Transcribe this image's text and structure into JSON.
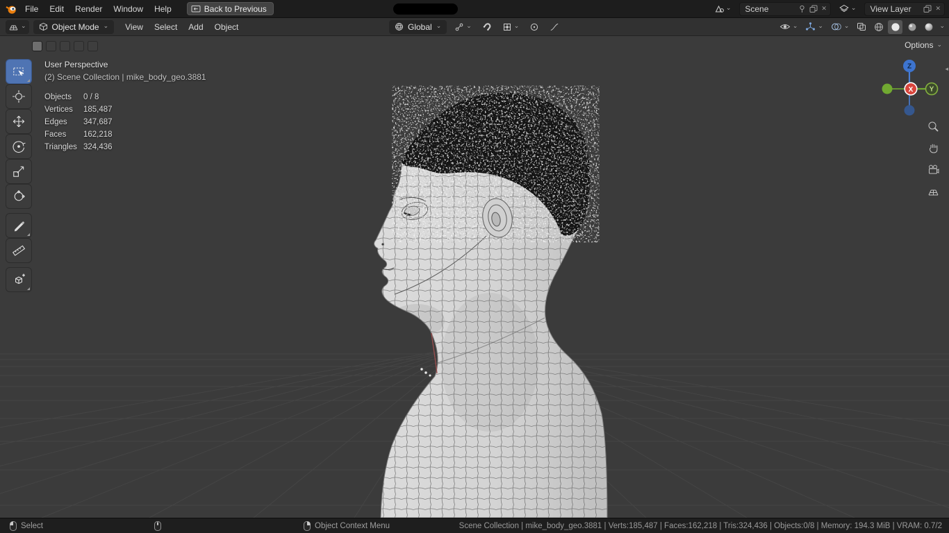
{
  "topbar": {
    "menus": [
      "File",
      "Edit",
      "Render",
      "Window",
      "Help"
    ],
    "back_button": "Back to Previous",
    "scene_field": "Scene",
    "view_layer_field": "View Layer"
  },
  "header": {
    "mode": "Object Mode",
    "menus": [
      "View",
      "Select",
      "Add",
      "Object"
    ],
    "orientation": "Global",
    "options": "Options"
  },
  "viewport_overlay": {
    "perspective": "User Perspective",
    "context": "(2) Scene Collection | mike_body_geo.3881",
    "stats": [
      {
        "label": "Objects",
        "value": "0 / 8"
      },
      {
        "label": "Vertices",
        "value": "185,487"
      },
      {
        "label": "Edges",
        "value": "347,687"
      },
      {
        "label": "Faces",
        "value": "162,218"
      },
      {
        "label": "Triangles",
        "value": "324,436"
      }
    ]
  },
  "gizmo": {
    "x": "X",
    "y": "Y",
    "z": "Z"
  },
  "toolbar_tools": [
    "box-select",
    "cursor",
    "move",
    "rotate",
    "scale",
    "transform",
    "annotate",
    "measure",
    "add-cube"
  ],
  "statusbar": {
    "select_label": "Select",
    "context_menu_label": "Object Context Menu",
    "info": "Scene Collection | mike_body_geo.3881 | Verts:185,487 | Faces:162,218 | Tris:324,436 | Objects:0/8 | Memory: 194.3 MiB | VRAM: 0.7/2"
  },
  "glyphs": {
    "chevron": "⌄",
    "close": "✕",
    "collapse": "◂"
  },
  "colors": {
    "accent": "#4f74b3",
    "axis_x": "#d8453c",
    "axis_y": "#71a931",
    "axis_z": "#3d74cf",
    "viewport_bg": "#3b3b3b"
  }
}
